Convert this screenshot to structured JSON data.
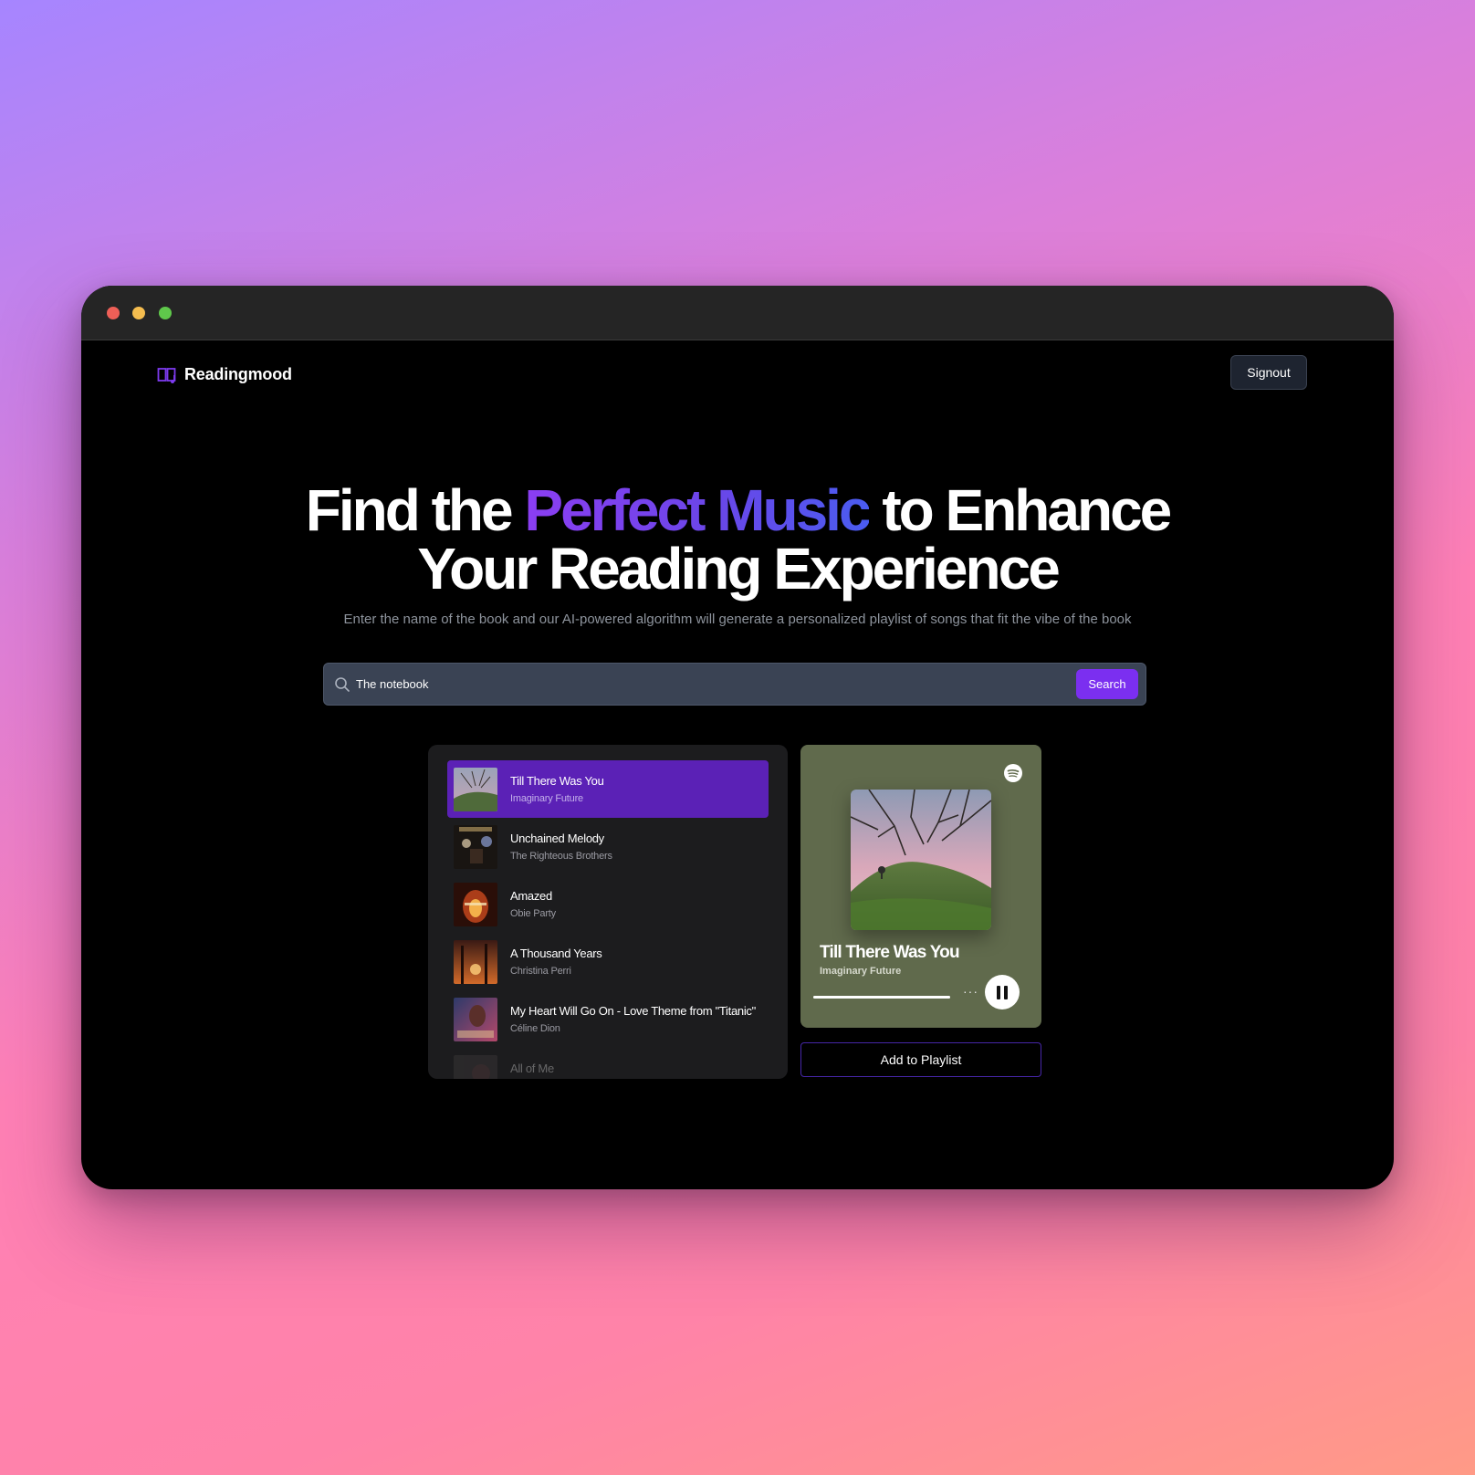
{
  "app": {
    "brand_name": "Readingmood",
    "signout_label": "Signout"
  },
  "hero": {
    "title_prefix": "Find the ",
    "title_accent": "Perfect Music",
    "title_suffix": " to Enhance",
    "title_line2": "Your Reading Experience",
    "subtitle": "Enter the name of the book and our AI-powered algorithm will generate a personalized playlist of songs that fit the vibe of the book"
  },
  "search": {
    "value": "The notebook",
    "button_label": "Search"
  },
  "songs": [
    {
      "title": "Till There Was You",
      "artist": "Imaginary Future"
    },
    {
      "title": "Unchained Melody",
      "artist": "The Righteous Brothers"
    },
    {
      "title": "Amazed",
      "artist": "Obie Party"
    },
    {
      "title": "A Thousand Years",
      "artist": "Christina Perri"
    },
    {
      "title": "My Heart Will Go On - Love Theme from \"Titanic\"",
      "artist": "Céline Dion"
    },
    {
      "title": "All of Me",
      "artist": ""
    }
  ],
  "player": {
    "title": "Till There Was You",
    "artist": "Imaginary Future",
    "progress": 1.0,
    "more_label": "···",
    "icons": [
      "spotify-icon",
      "pause-icon",
      "more-icon"
    ]
  },
  "add_to_playlist_label": "Add to Playlist",
  "colors": {
    "accent": "#7b2ff0",
    "active_song": "#5b21b6",
    "player_bg": "#606a4c"
  }
}
